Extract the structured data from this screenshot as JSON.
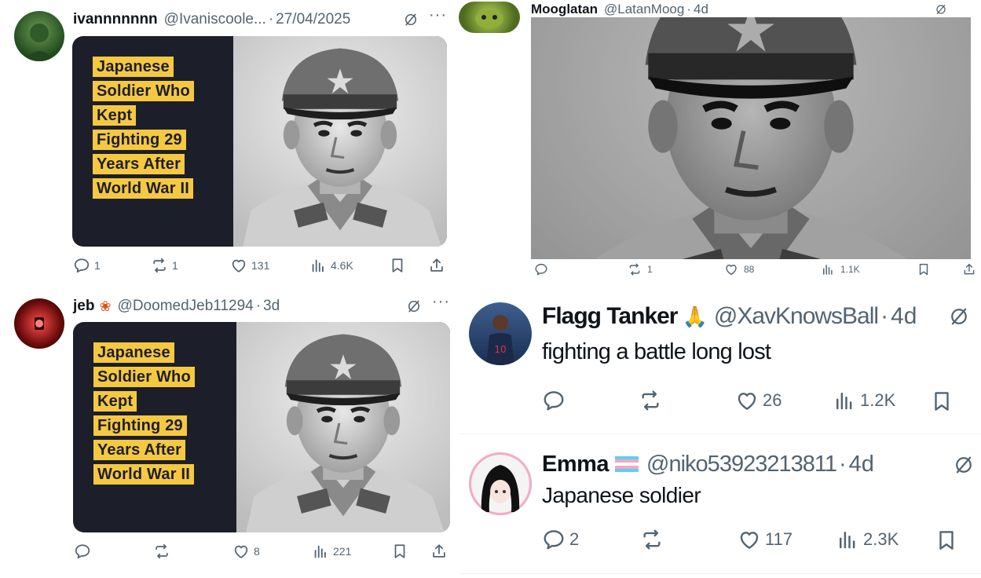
{
  "tweets": [
    {
      "name": "ivannnnnnn",
      "handle": "@Ivaniscoole...",
      "dot": "·",
      "time": "27/04/2025",
      "caption": [
        "Japanese",
        "Soldier Who",
        "Kept",
        "Fighting 29",
        "Years After",
        "World War II"
      ],
      "replies": "1",
      "reposts": "1",
      "likes": "131",
      "views": "4.6K"
    },
    {
      "name": "Mooglatan",
      "handle": "@LatanMoog",
      "dot": "·",
      "time": "4d",
      "replies": "",
      "reposts": "1",
      "likes": "88",
      "views": "1.1K"
    },
    {
      "name": "jeb",
      "handle": "@DoomedJeb11294",
      "dot": "·",
      "time": "3d",
      "caption": [
        "Japanese",
        "Soldier Who",
        "Kept",
        "Fighting 29",
        "Years After",
        "World War II"
      ],
      "replies": "",
      "reposts": "",
      "likes": "8",
      "views": "221"
    },
    {
      "name": "Flagg Tanker",
      "emoji": "🙏",
      "handle": "@XavKnowsBall",
      "dot": "·",
      "time": "4d",
      "text": "fighting a battle long lost",
      "replies": "",
      "reposts": "",
      "likes": "26",
      "views": "1.2K"
    },
    {
      "name": "Emma",
      "handle": "@niko53923213811",
      "dot": "·",
      "time": "4d",
      "text": "Japanese soldier",
      "replies": "2",
      "reposts": "",
      "likes": "117",
      "views": "2.3K"
    }
  ],
  "colors": {
    "accent_yellow": "#f5c842",
    "meta_gray": "#536471",
    "dark_panel": "#1c1e29"
  }
}
